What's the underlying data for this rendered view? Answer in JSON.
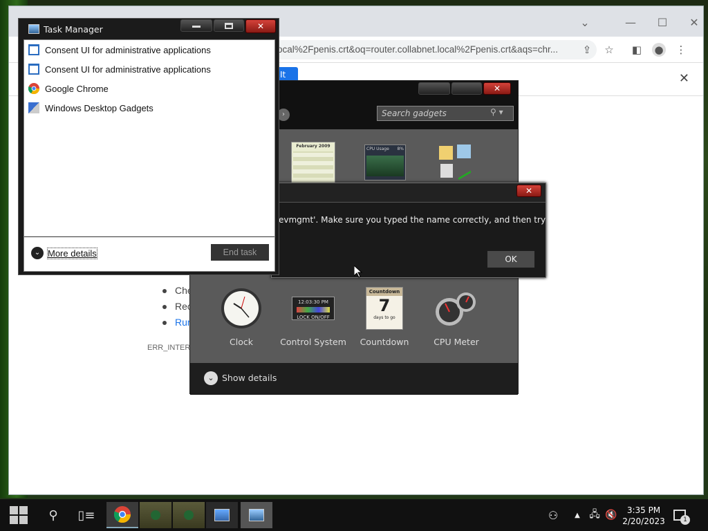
{
  "chrome": {
    "url": "ocal%2Fpenis.crt&oq=router.collabnet.local%2Fpenis.crt&aqs=chr...",
    "infobar_button": "It",
    "error_list": [
      "Che",
      "Rec",
      "Rur"
    ],
    "error_code": "ERR_INTERN"
  },
  "gadgets": {
    "search_placeholder": "Search gadgets",
    "items": [
      {
        "name": "Clock",
        "icon": "clock-icon"
      },
      {
        "name": "Control System",
        "icon": "control-system-icon"
      },
      {
        "name": "Countdown",
        "icon": "countdown-icon"
      },
      {
        "name": "CPU Meter",
        "icon": "cpu-meter-icon"
      }
    ],
    "calendar_thumb": {
      "month": "February 2009"
    },
    "cpu_thumb": {
      "title": "CPU Usage",
      "value": "8%"
    },
    "control_thumb": {
      "time": "12:03:30 PM",
      "label": "LOCK ON/OFF"
    },
    "countdown_thumb": {
      "title": "Countdown",
      "day": "7",
      "sub": "days to go"
    },
    "show_details": "Show details"
  },
  "error_dialog": {
    "message": "evmgmt'. Make sure you typed the name correctly, and then try",
    "ok_label": "OK",
    "close_label": "✕"
  },
  "task_manager": {
    "title": "Task Manager",
    "processes": [
      {
        "name": "Consent UI for administrative applications",
        "icon": "window-icon"
      },
      {
        "name": "Consent UI for administrative applications",
        "icon": "window-icon"
      },
      {
        "name": "Google Chrome",
        "icon": "chrome-icon"
      },
      {
        "name": "Windows Desktop Gadgets",
        "icon": "gadgets-icon"
      }
    ],
    "more_details": "More details",
    "end_task": "End task"
  },
  "taskbar": {
    "time": "3:35 PM",
    "date": "2/20/2023",
    "notification_count": "1"
  }
}
